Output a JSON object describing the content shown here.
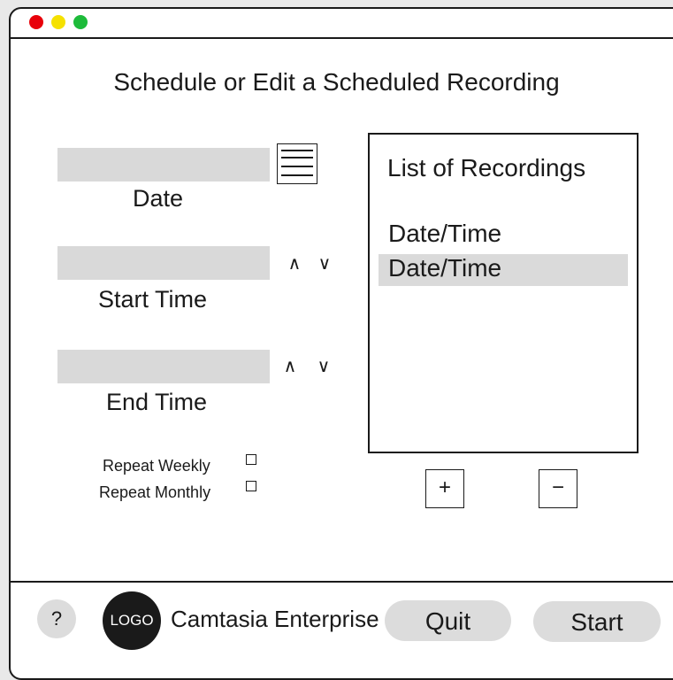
{
  "window": {
    "controls": [
      "close",
      "minimize",
      "maximize"
    ],
    "colors": {
      "close": "#e8000a",
      "minimize": "#f5e100",
      "maximize": "#1dbb3a"
    }
  },
  "page_title": "Schedule or Edit a Scheduled Recording",
  "form": {
    "date": {
      "label": "Date",
      "value": ""
    },
    "start_time": {
      "label": "Start Time",
      "value": "",
      "up": "∧",
      "down": "∨"
    },
    "end_time": {
      "label": "End Time",
      "value": "",
      "up": "∧",
      "down": "∨"
    },
    "repeat_weekly": {
      "label": "Repeat Weekly",
      "checked": false
    },
    "repeat_monthly": {
      "label": "Repeat Monthly",
      "checked": false
    }
  },
  "recordings": {
    "title": "List of Recordings",
    "items": [
      {
        "label": "Date/Time",
        "selected": false
      },
      {
        "label": "Date/Time",
        "selected": true
      }
    ],
    "add_label": "+",
    "remove_label": "−"
  },
  "footer": {
    "help_label": "?",
    "logo_text": "LOGO",
    "app_name": "Camtasia Enterprise",
    "quit_label": "Quit",
    "start_label": "Start"
  }
}
